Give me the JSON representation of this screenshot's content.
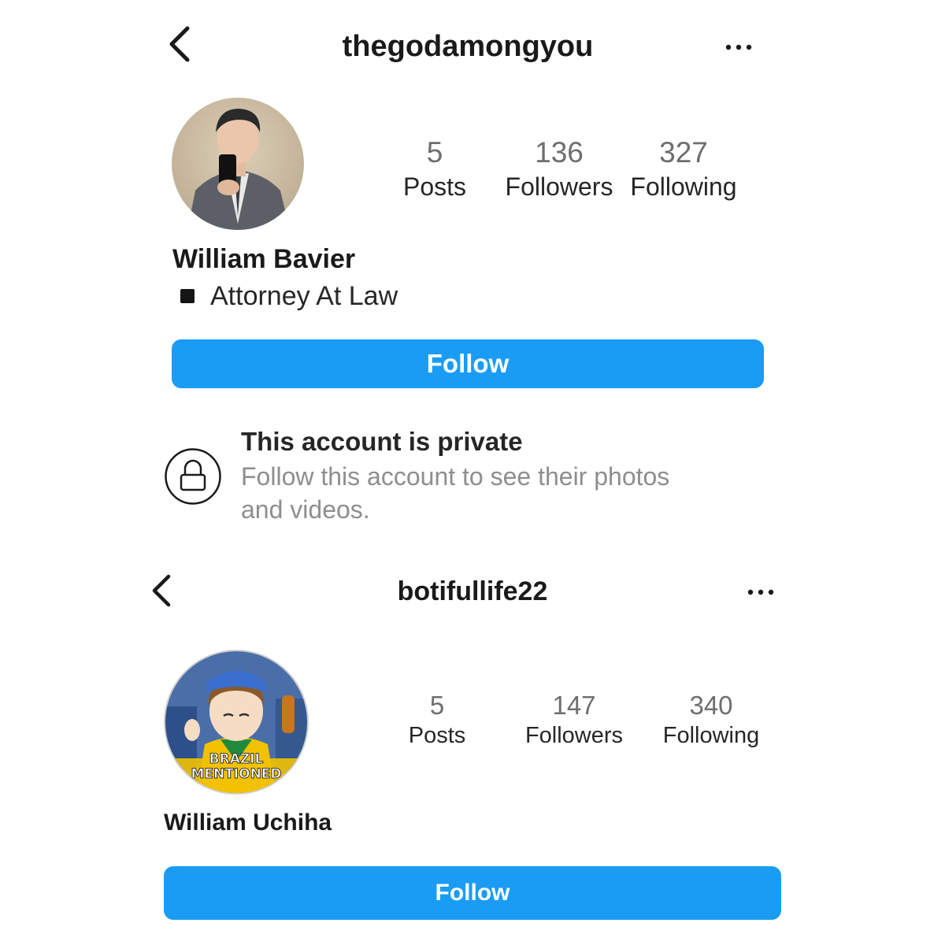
{
  "profile1": {
    "username": "thegodamongyou",
    "icons": {
      "back": "chevron-left-icon",
      "more": "more-horizontal-icon",
      "lock": "lock-icon",
      "bio_emoji": "black-square-icon"
    },
    "stats": [
      {
        "value": "5",
        "label": "Posts"
      },
      {
        "value": "136",
        "label": "Followers"
      },
      {
        "value": "327",
        "label": "Following"
      }
    ],
    "display_name": "William Bavier",
    "bio": "Attorney At Law",
    "follow_label": "Follow",
    "private": {
      "title": "This account is private",
      "line1": "Follow this account to see their photos",
      "line2": "and videos."
    }
  },
  "profile2": {
    "username": "botifullife22",
    "icons": {
      "back": "chevron-left-icon",
      "more": "more-horizontal-icon"
    },
    "avatar_text": {
      "line1": "BRAZIL",
      "line2": "MENTIONED"
    },
    "stats": [
      {
        "value": "5",
        "label": "Posts"
      },
      {
        "value": "147",
        "label": "Followers"
      },
      {
        "value": "340",
        "label": "Following"
      }
    ],
    "display_name": "William Uchiha",
    "follow_label": "Follow"
  },
  "colors": {
    "follow_button": "#1a9cf5",
    "text": "#262626",
    "muted": "#8e8e8e"
  }
}
